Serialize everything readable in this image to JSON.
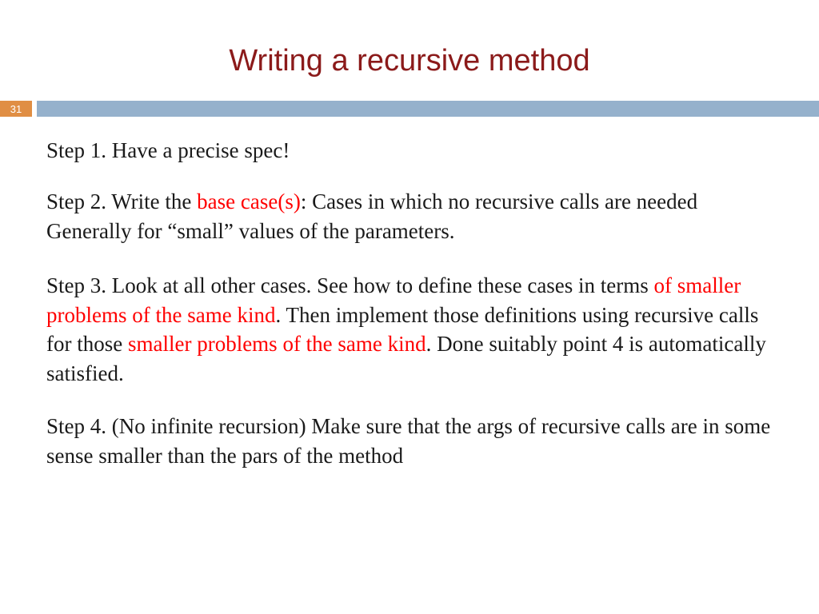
{
  "title": "Writing a recursive method",
  "page_number": "31",
  "step1": {
    "text": "Step 1. Have a precise spec!"
  },
  "step2": {
    "part_a": "Step 2. Write the ",
    "red_a": "base case(s)",
    "part_b": ": Cases in which no recursive calls are needed Generally for “small” values of the parameters."
  },
  "step3": {
    "part_a": "Step 3. Look at all other cases. See how to define these cases in terms ",
    "red_a": "of smaller problems of the same kind",
    "part_b": ". Then implement those definitions using recursive calls for those ",
    "red_b": "smaller problems of the same kind",
    "part_c": ". Done suitably point 4 is automatically satisfied."
  },
  "step4": {
    "text": "Step 4. (No infinite recursion) Make sure that the args of recursive calls are in some sense smaller than the pars of the method"
  }
}
